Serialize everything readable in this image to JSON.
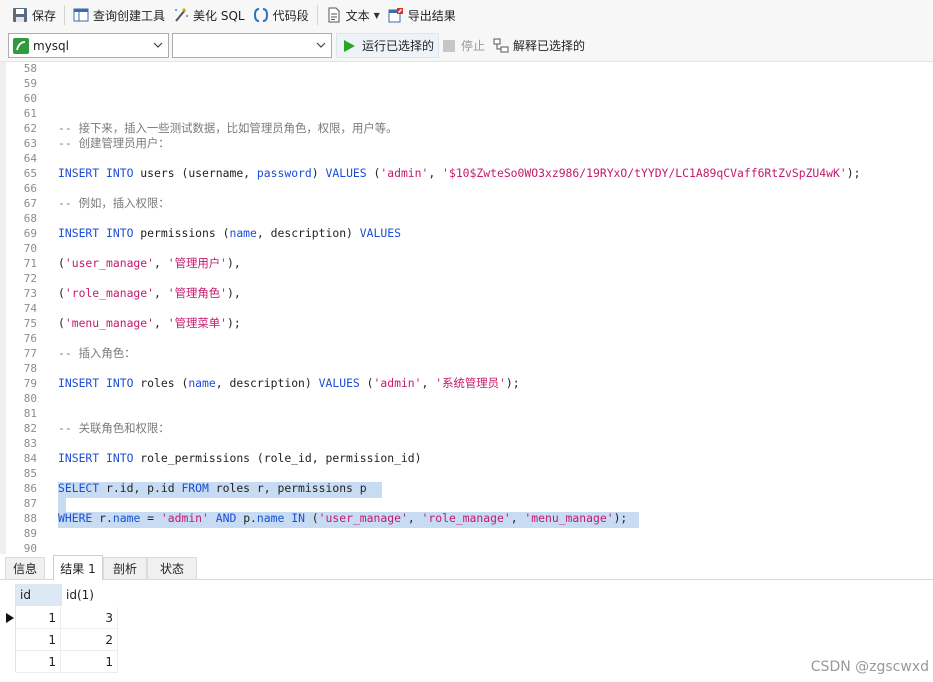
{
  "toolbar": {
    "save_label": "保存",
    "query_builder_label": "查询创建工具",
    "beautify_sql_label": "美化 SQL",
    "snippet_label": "代码段",
    "text_label": "文本",
    "export_label": "导出结果"
  },
  "toolbar2": {
    "connection_value": "mysql",
    "database_value": "",
    "run_selected_label": "运行已选择的",
    "stop_label": "停止",
    "explain_selected_label": "解释已选择的"
  },
  "editor": {
    "lines": [
      {
        "n": "58",
        "t": ""
      },
      {
        "n": "59",
        "t": ""
      },
      {
        "n": "60",
        "t": ""
      },
      {
        "n": "61",
        "t": ""
      },
      {
        "n": "62",
        "t": "-- 接下来，插入一些测试数据，比如管理员角色，权限，用户等。"
      },
      {
        "n": "63",
        "t": "-- 创建管理员用户："
      },
      {
        "n": "64",
        "t": ""
      },
      {
        "n": "65",
        "t": "INSERT INTO users (username, password) VALUES ('admin', '$10$ZwteSo0WO3xz986/19RYxO/tYYDY/LC1A89qCVaff6RtZvSpZU4wK');"
      },
      {
        "n": "66",
        "t": ""
      },
      {
        "n": "67",
        "t": "-- 例如，插入权限："
      },
      {
        "n": "68",
        "t": ""
      },
      {
        "n": "69",
        "t": "INSERT INTO permissions (name, description) VALUES"
      },
      {
        "n": "70",
        "t": ""
      },
      {
        "n": "71",
        "t": "('user_manage', '管理用户'),"
      },
      {
        "n": "72",
        "t": ""
      },
      {
        "n": "73",
        "t": "('role_manage', '管理角色'),"
      },
      {
        "n": "74",
        "t": ""
      },
      {
        "n": "75",
        "t": "('menu_manage', '管理菜单');"
      },
      {
        "n": "76",
        "t": ""
      },
      {
        "n": "77",
        "t": "-- 插入角色："
      },
      {
        "n": "78",
        "t": ""
      },
      {
        "n": "79",
        "t": "INSERT INTO roles (name, description) VALUES ('admin', '系统管理员');"
      },
      {
        "n": "80",
        "t": ""
      },
      {
        "n": "81",
        "t": ""
      },
      {
        "n": "82",
        "t": "-- 关联角色和权限："
      },
      {
        "n": "83",
        "t": ""
      },
      {
        "n": "84",
        "t": "INSERT INTO role_permissions (role_id, permission_id)"
      },
      {
        "n": "85",
        "t": ""
      },
      {
        "n": "86",
        "t": "SELECT r.id, p.id FROM roles r, permissions p"
      },
      {
        "n": "87",
        "t": ""
      },
      {
        "n": "88",
        "t": "WHERE r.name = 'admin' AND p.name IN ('user_manage', 'role_manage', 'menu_manage');"
      },
      {
        "n": "89",
        "t": ""
      },
      {
        "n": "90",
        "t": ""
      }
    ]
  },
  "tabs": [
    "信息",
    "结果 1",
    "剖析",
    "状态"
  ],
  "result": {
    "columns": [
      "id",
      "id(1)"
    ],
    "rows": [
      [
        "1",
        "3"
      ],
      [
        "1",
        "2"
      ],
      [
        "1",
        "1"
      ]
    ]
  },
  "watermark": "CSDN @zgscwxd",
  "colors": {
    "keyword": "#1c4dd6",
    "string": "#c41a6b",
    "comment": "#7a7a7a",
    "selection": "#c7dcf3",
    "run_icon": "#2aa52a"
  },
  "icons": [
    "save-icon",
    "query-builder-icon",
    "beautify-icon",
    "snippet-icon",
    "text-icon",
    "export-icon",
    "mysql-connection-icon",
    "run-icon",
    "stop-icon",
    "explain-icon",
    "current-row-icon"
  ]
}
